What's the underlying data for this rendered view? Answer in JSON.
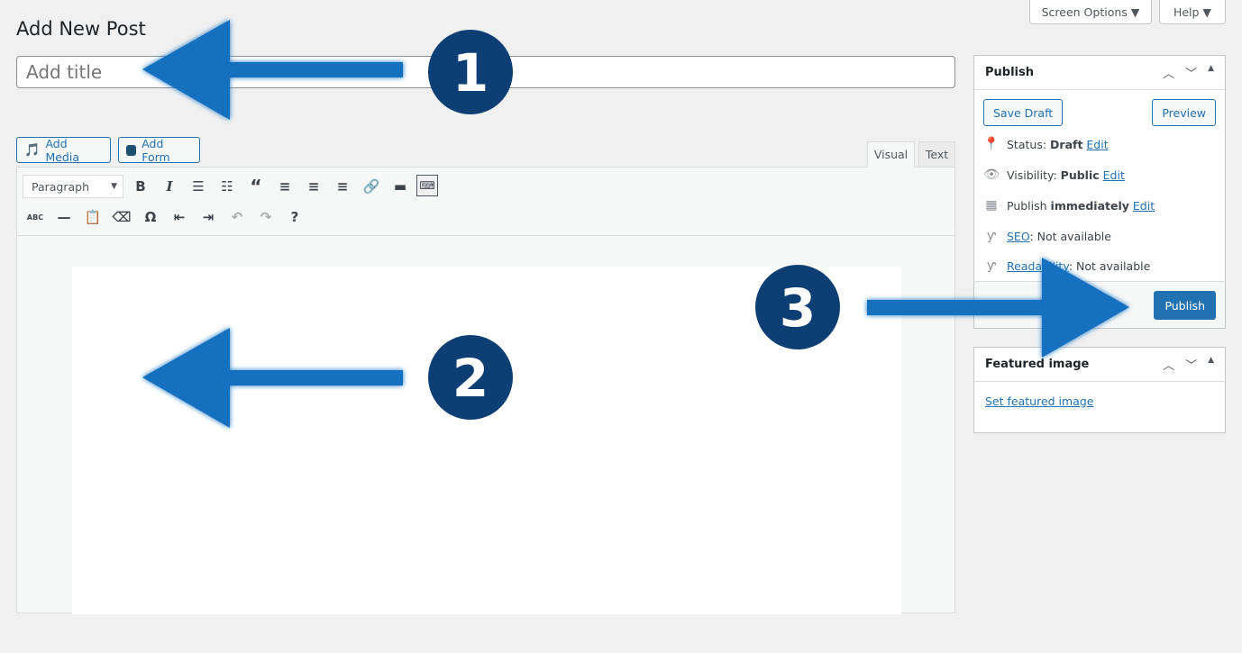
{
  "header": {
    "title": "Add New Post",
    "screen_options": "Screen Options ▼",
    "help": "Help ▼"
  },
  "title_input": {
    "placeholder": "Add title",
    "value": ""
  },
  "media": {
    "add_media": "Add Media",
    "add_form": "Add Form"
  },
  "editor_tabs": {
    "visual": "Visual",
    "text": "Text"
  },
  "toolbar": {
    "format": "Paragraph",
    "row1": [
      "bold-icon",
      "italic-icon",
      "bullet-list-icon",
      "numbered-list-icon",
      "blockquote-icon",
      "align-left-icon",
      "align-center-icon",
      "align-right-icon",
      "link-icon",
      "read-more-icon",
      "toolbar-toggle-icon"
    ],
    "row2": [
      "strikethrough-icon",
      "horizontal-line-icon",
      "paste-text-icon",
      "clear-formatting-icon",
      "special-character-icon",
      "outdent-icon",
      "indent-icon",
      "undo-icon",
      "redo-icon",
      "help-icon"
    ]
  },
  "publish": {
    "title": "Publish",
    "save_draft": "Save Draft",
    "preview": "Preview",
    "status_label": "Status: ",
    "status_value": "Draft",
    "visibility_label": "Visibility: ",
    "visibility_value": "Public",
    "publish_label": "Publish ",
    "publish_value": "immediately",
    "edit": "Edit",
    "seo_link": "SEO",
    "seo_value": ": Not available",
    "readability_link": "Readability",
    "readability_value": ": Not available",
    "publish_button": "Publish"
  },
  "featured": {
    "title": "Featured image",
    "link": "Set featured image"
  },
  "annotations": {
    "one": "1",
    "two": "2",
    "three": "3",
    "arrow_color": "#1470c0",
    "circle_color": "#0e3f74"
  }
}
